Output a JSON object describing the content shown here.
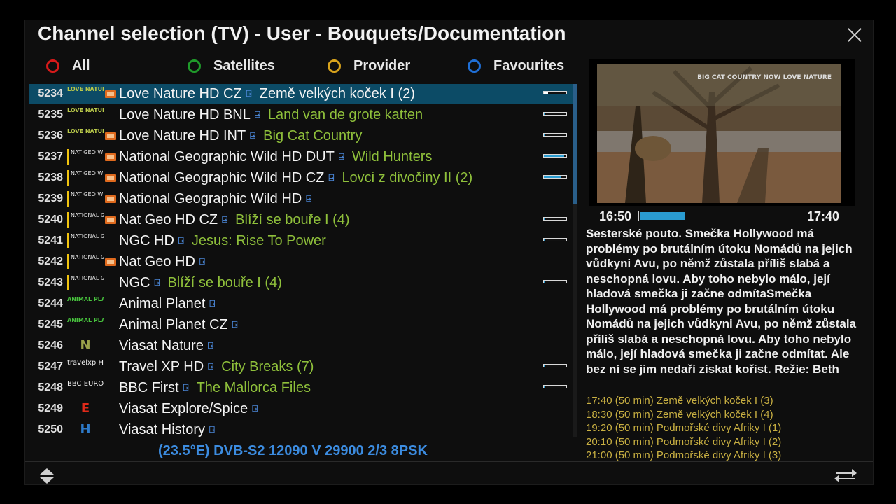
{
  "window": {
    "title": "Channel selection (TV) - User - Bouquets/Documentation"
  },
  "color_keys": [
    {
      "label": "All",
      "color": "#d71a1a"
    },
    {
      "label": "Satellites",
      "color": "#1f9a2a"
    },
    {
      "label": "Provider",
      "color": "#d8a31c"
    },
    {
      "label": "Favourites",
      "color": "#1f6fd6"
    }
  ],
  "channels": [
    {
      "num": "5234",
      "logo": "LOVE NATURE",
      "hd": true,
      "name": "Love Nature HD CZ",
      "program": "Země velkých koček I (2)",
      "progress": 0.18,
      "selected": true
    },
    {
      "num": "5235",
      "logo": "LOVE NATURE",
      "hd": false,
      "name": "Love Nature HD BNL",
      "program": "Land van de grote katten",
      "progress": 0.03
    },
    {
      "num": "5236",
      "logo": "LOVE NATURE",
      "hd": true,
      "name": "Love Nature HD INT",
      "program": "Big Cat Country",
      "progress": 0.03
    },
    {
      "num": "5237",
      "logo": "NAT GEO WILD",
      "hd": true,
      "name": "National Geographic Wild HD DUT",
      "program": "Wild Hunters",
      "progress": 0.9
    },
    {
      "num": "5238",
      "logo": "NAT GEO WILD",
      "hd": true,
      "name": "National Geographic Wild HD CZ",
      "program": "Lovci z divočiny II (2)",
      "progress": 0.75
    },
    {
      "num": "5239",
      "logo": "NAT GEO WILD",
      "hd": true,
      "name": "National Geographic Wild HD",
      "program": "",
      "progress": null
    },
    {
      "num": "5240",
      "logo": "NATIONAL GEOGRAPHIC CHANNEL",
      "hd": true,
      "name": "Nat Geo HD CZ",
      "program": "Blíží se bouře I (4)",
      "progress": 0.03
    },
    {
      "num": "5241",
      "logo": "NATIONAL GEOGRAPHIC CHANNEL",
      "hd": false,
      "name": "NGC HD",
      "program": "Jesus: Rise To Power",
      "progress": 0.03
    },
    {
      "num": "5242",
      "logo": "NATIONAL GEOGRAPHIC CHANNEL",
      "hd": true,
      "name": "Nat Geo HD",
      "program": "",
      "progress": null
    },
    {
      "num": "5243",
      "logo": "NATIONAL GEOGRAPHIC CHANNEL",
      "hd": false,
      "name": "NGC",
      "program": "Blíží se bouře I (4)",
      "progress": 0.03
    },
    {
      "num": "5244",
      "logo": "ANIMAL PLANET",
      "hd": false,
      "name": "Animal Planet",
      "program": "",
      "progress": null
    },
    {
      "num": "5245",
      "logo": "ANIMAL PLANET",
      "hd": false,
      "name": "Animal Planet CZ",
      "program": "",
      "progress": null
    },
    {
      "num": "5246",
      "logo": "N",
      "hd": false,
      "name": "Viasat Nature",
      "program": "",
      "progress": null
    },
    {
      "num": "5247",
      "logo": "travelxp HD",
      "hd": false,
      "name": "Travel XP HD",
      "program": "City Breaks (7)",
      "progress": 0.03
    },
    {
      "num": "5248",
      "logo": "BBC EUROPE",
      "hd": false,
      "name": "BBC First",
      "program": "The Mallorca Files",
      "progress": 0.03
    },
    {
      "num": "5249",
      "logo": "E",
      "hd": false,
      "name": "Viasat Explore/Spice",
      "program": "",
      "progress": null
    },
    {
      "num": "5250",
      "logo": "H",
      "hd": false,
      "name": "Viasat History",
      "program": "",
      "progress": null
    }
  ],
  "transponder": "(23.5°E) DVB-S2 12090 V 29900 2/3 8PSK",
  "preview": {
    "watermark": "BIG CAT COUNTRY  NOW  LOVE NATURE"
  },
  "time": {
    "start": "16:50",
    "end": "17:40",
    "progress": 0.28
  },
  "description": "Sesterské pouto. Smečka Hollywood má problémy po brutálním útoku Nomádů na jejich vůdkyni Avu, po němž zůstala příliš slabá a neschopná lovu. Aby toho nebylo málo, její hladová smečka ji začne odmítaSmečka Hollywood má problémy po brutálním útoku Nomádů na jejich vůdkyni Avu, po němž zůstala příliš slabá a neschopná lovu. Aby toho nebylo málo, její hladová smečka ji začne odmítat. Ale bez ní se jim nedaří získat kořist. Režie: Beth",
  "upcoming": [
    "17:40 (50 min) Země velkých koček I (3)",
    "18:30 (50 min) Země velkých koček I (4)",
    "19:20 (50 min) Podmořské divy Afriky I (1)",
    "20:10 (50 min) Podmořské divy Afriky I (2)",
    "21:00 (50 min) Podmořské divy Afriky I (3)"
  ],
  "icons": {
    "close": "close-icon",
    "updown": "up-down-arrows-icon",
    "swap": "swap-arrows-icon",
    "channel": "satellite-dish-icon"
  }
}
